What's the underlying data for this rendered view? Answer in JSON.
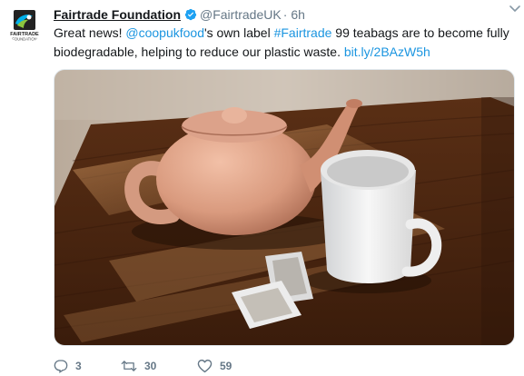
{
  "account": {
    "name": "Fairtrade Foundation",
    "handle": "@FairtradeUK",
    "time": "6h",
    "avatar_text_top": "FAIRTRADE",
    "avatar_text_bottom": "FOUNDATION",
    "verified_icon": "verified-badge-icon"
  },
  "tweet": {
    "text_prefix": "Great news! ",
    "mention": "@coopukfood",
    "text_mid": "'s own label ",
    "hashtag": "#Fairtrade",
    "text_suffix": " 99 teabags are to become fully biodegradable, helping to reduce our plastic waste. ",
    "url": "bit.ly/2BAzW5h"
  },
  "media": {
    "photo_icon": "teapot-cup-teabags-photo"
  },
  "actions": {
    "reply_count": "3",
    "retweet_count": "30",
    "like_count": "59",
    "reply_icon": "reply-icon",
    "retweet_icon": "retweet-icon",
    "like_icon": "heart-icon"
  },
  "colors": {
    "link": "#1b95e0",
    "muted": "#657786",
    "text": "#14171a",
    "verified": "#1da1f2"
  }
}
